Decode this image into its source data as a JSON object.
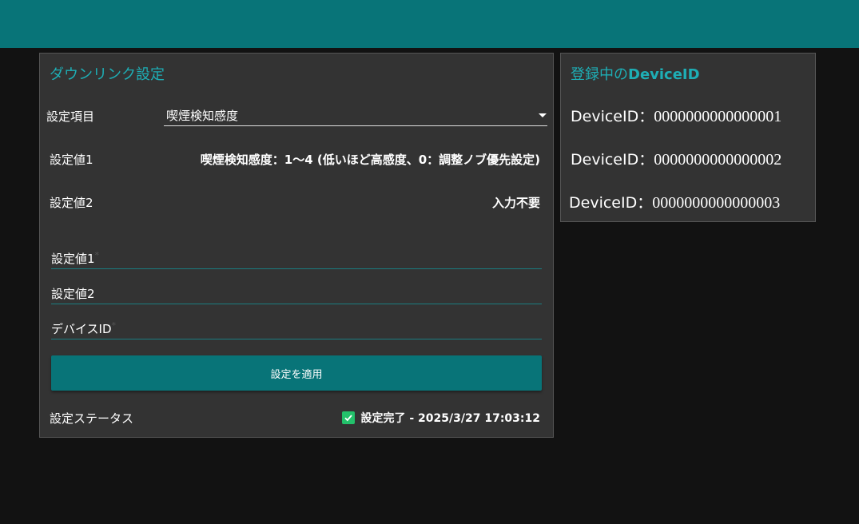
{
  "colors": {
    "header": "#087478",
    "accent": "#1eaeb5",
    "card_bg": "#333333",
    "page_bg": "#121212",
    "success": "#23c16b"
  },
  "downlink": {
    "title": "ダウンリンク設定",
    "setting_item_label": "設定項目",
    "setting_item_value": "喫煙検知感度",
    "value1_label": "設定値1",
    "value1_desc": "喫煙検知感度：1〜4 (低いほど高感度、0：調整ノブ優先設定)",
    "value2_label": "設定値2",
    "value2_desc": "入力不要",
    "input_value1_label": "設定値1",
    "input_value1_required": "*",
    "input_value2_label": "設定値2",
    "input_device_label": "デバイスID",
    "input_device_required": "*",
    "apply_label": "設定を適用",
    "status_label": "設定ステータス",
    "status_value": "設定完了 - 2025/3/27 17:03:12",
    "status_icon": "check-icon"
  },
  "devices": {
    "title_prefix": "登録中の",
    "title_strong": "DeviceID",
    "label": "DeviceID：",
    "items": [
      {
        "id": "0000000000000001"
      },
      {
        "id": "0000000000000002"
      },
      {
        "id": "0000000000000003"
      }
    ]
  }
}
